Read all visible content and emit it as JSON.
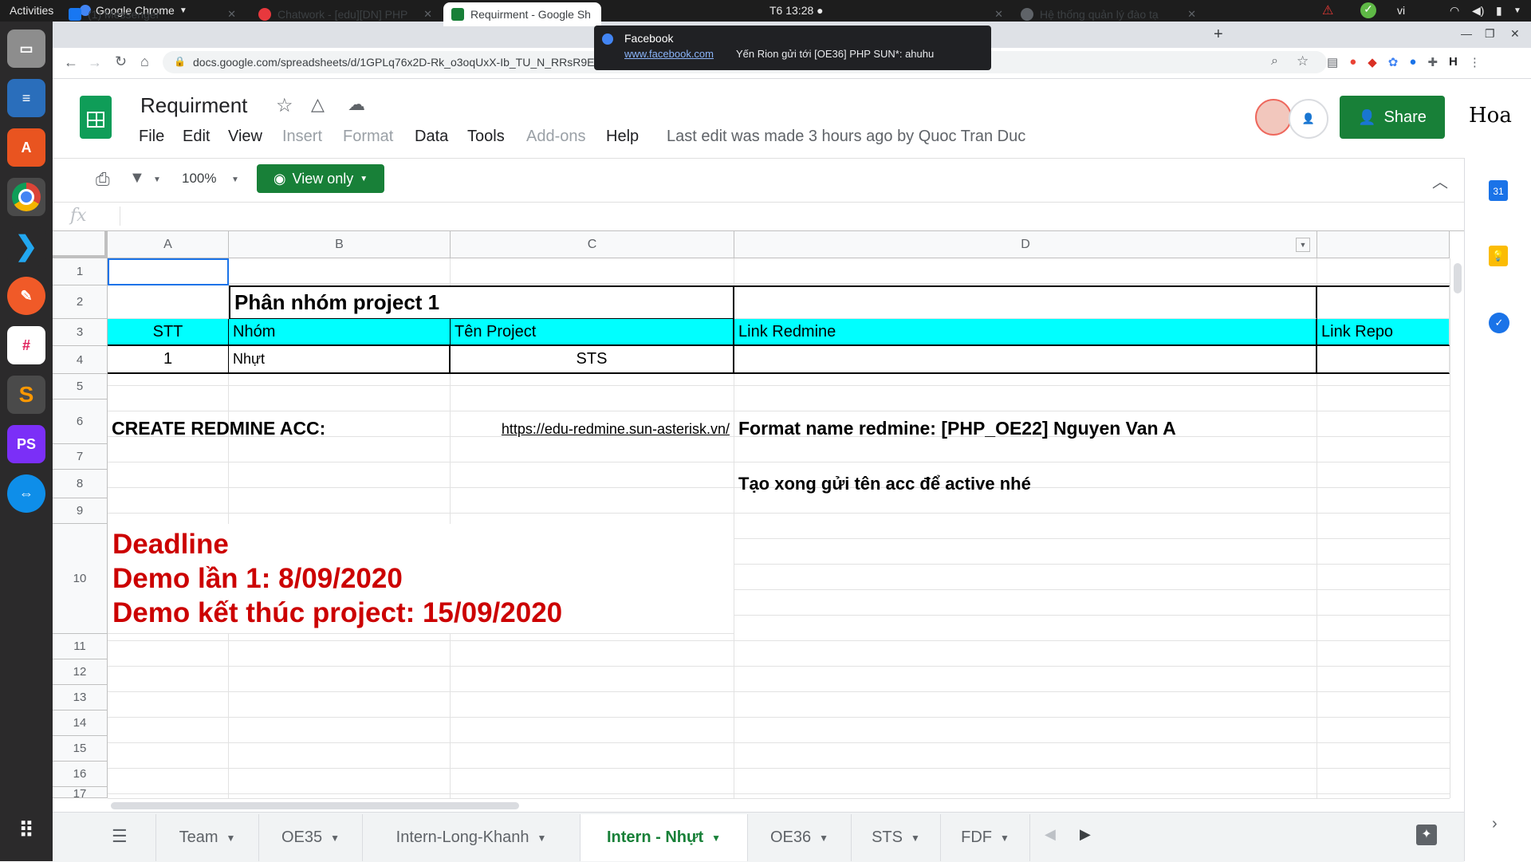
{
  "system": {
    "activities": "Activities",
    "app_name": "Google Chrome",
    "clock": "T6 13:28 ●",
    "lang": "vi"
  },
  "browser": {
    "tabs": [
      {
        "label": "(1) Messenger",
        "color": "#1877f2"
      },
      {
        "label": "Chatwork - [edu][DN] PHP",
        "color": "#e8383d"
      },
      {
        "label": "Requirment - Google Sh",
        "color": "#188038"
      },
      {
        "label": "Hệ thống quản lý đào tạ",
        "color": "#5f6368"
      }
    ],
    "url": "docs.google.com/spreadsheets/d/1GPLq76x2D-Rk_o3oqUxX-Ib_TU_N_RRsR9E9"
  },
  "notification": {
    "title": "Facebook",
    "link": "www.facebook.com",
    "message": "Yến Rion gửi tới [OE36] PHP SUN*: ahuhu"
  },
  "sheets": {
    "doc_title": "Requirment",
    "menus": [
      "File",
      "Edit",
      "View",
      "Insert",
      "Format",
      "Data",
      "Tools",
      "Add-ons",
      "Help"
    ],
    "last_edit": "Last edit was made 3 hours ago by Quoc Tran Duc",
    "share_label": "Share",
    "account_label": "Hoa",
    "zoom": "100%",
    "view_only_label": "View only",
    "fx_label": "fx",
    "columns": [
      "A",
      "B",
      "C",
      "D"
    ],
    "rows": [
      "1",
      "2",
      "3",
      "4",
      "5",
      "6",
      "7",
      "8",
      "9",
      "10",
      "11",
      "12",
      "13",
      "14",
      "15",
      "16",
      "17"
    ],
    "cells": {
      "r2_title": "Phân nhóm project 1",
      "r3_stt": "STT",
      "r3_nhom": "Nhóm",
      "r3_project": "Tên Project",
      "r3_redmine": "Link Redmine",
      "r3_repo": "Link Repo",
      "r4_stt": "1",
      "r4_nhom": "Nhựt",
      "r4_project": "STS",
      "r6_create": "CREATE REDMINE ACC:",
      "r6_link": "https://edu-redmine.sun-asterisk.vn/",
      "r6_format": "Format name redmine: [PHP_OE22] Nguyen Van A",
      "r8_note": "Tạo xong gửi tên acc để active nhé",
      "r10_line1": "Deadline",
      "r10_line2": "Demo lần 1: 8/09/2020",
      "r10_line3": "Demo kết thúc project: 15/09/2020"
    },
    "sheet_tabs": [
      "Team",
      "OE35",
      "Intern-Long-Khanh",
      "Intern - Nhựt",
      "OE36",
      "STS",
      "FDF"
    ],
    "active_sheet": "Intern - Nhựt",
    "side_calendar_label": "31"
  }
}
